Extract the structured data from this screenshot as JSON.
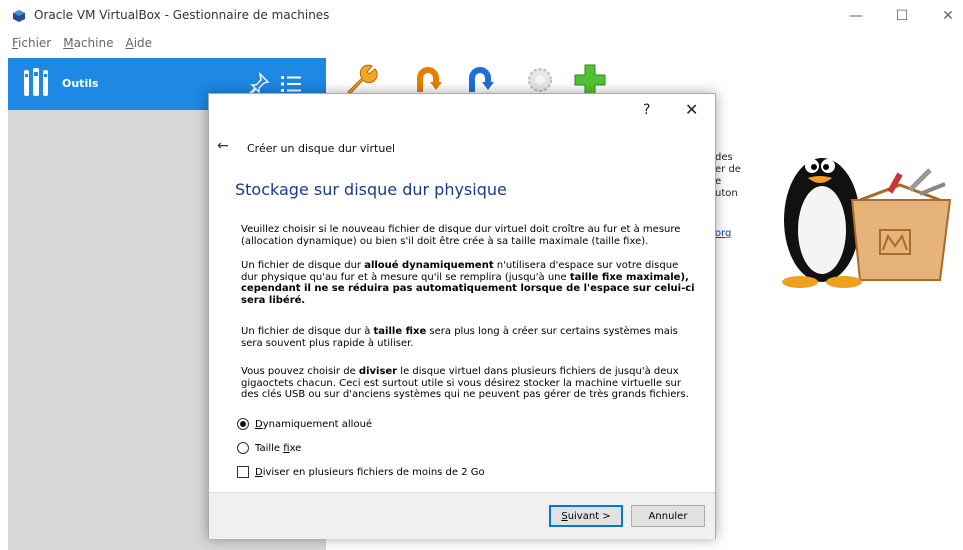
{
  "window": {
    "title": "Oracle VM VirtualBox - Gestionnaire de machines"
  },
  "menu": [
    {
      "mnemonic": "F",
      "rest": "ichier"
    },
    {
      "mnemonic": "M",
      "rest": "achine"
    },
    {
      "mnemonic": "A",
      "rest": "ide"
    }
  ],
  "sidebar": {
    "tools_label": "Outils"
  },
  "background": {
    "lines": [
      "des",
      "er de",
      "e",
      "uton"
    ],
    "link": "org"
  },
  "dialog": {
    "help": "?",
    "close": "✕",
    "back": "←",
    "wizard_title": "Créer un disque dur virtuel",
    "heading": "Stockage sur disque dur physique",
    "p1": "Veuillez choisir si le nouveau fichier de disque dur virtuel doit croître au fur et à mesure (allocation dynamique) ou bien s'il doit être crée à sa taille maximale (taille fixe).",
    "p2_a": "Un fichier de disque dur ",
    "p2_b": "alloué dynamiquement",
    "p2_c": " n'utilisera d'espace sur votre disque dur physique qu'au fur et à mesure qu'il se remplira (jusqu'à une ",
    "p2_d": "taille fixe maximale),",
    "p2_e": " cependant il ne se réduira pas automatiquement lorsque de l'espace sur celui-ci sera libéré.",
    "p3_a": "Un fichier de disque dur à ",
    "p3_b": "taille fixe",
    "p3_c": " sera plus long à créer sur certains systèmes mais sera souvent plus rapide à utiliser.",
    "p4_a": "Vous pouvez choisir de ",
    "p4_b": "diviser",
    "p4_c": " le disque virtuel dans plusieurs fichiers de jusqu'à deux gigaoctets chacun. Ceci est surtout utile si vous désirez stocker la machine virtuelle sur des clés USB ou sur d'anciens systèmes qui ne peuvent pas gérer de très grands fichiers.",
    "opt_dynamic": {
      "mnemonic": "D",
      "rest": "ynamiquement alloué"
    },
    "opt_fixed": {
      "before": "Taille ",
      "mnemonic": "f",
      "after": "ixe"
    },
    "opt_split": {
      "mnemonic": "D",
      "rest": "iviser en plusieurs fichiers de moins de 2 Go"
    },
    "next_button": {
      "mnemonic": "S",
      "rest": "uivant >"
    },
    "cancel_button": "Annuler"
  },
  "colors": {
    "accent": "#1e88e5",
    "heading": "#1a3a8a",
    "sidebar_bg": "#d7d7d7"
  }
}
